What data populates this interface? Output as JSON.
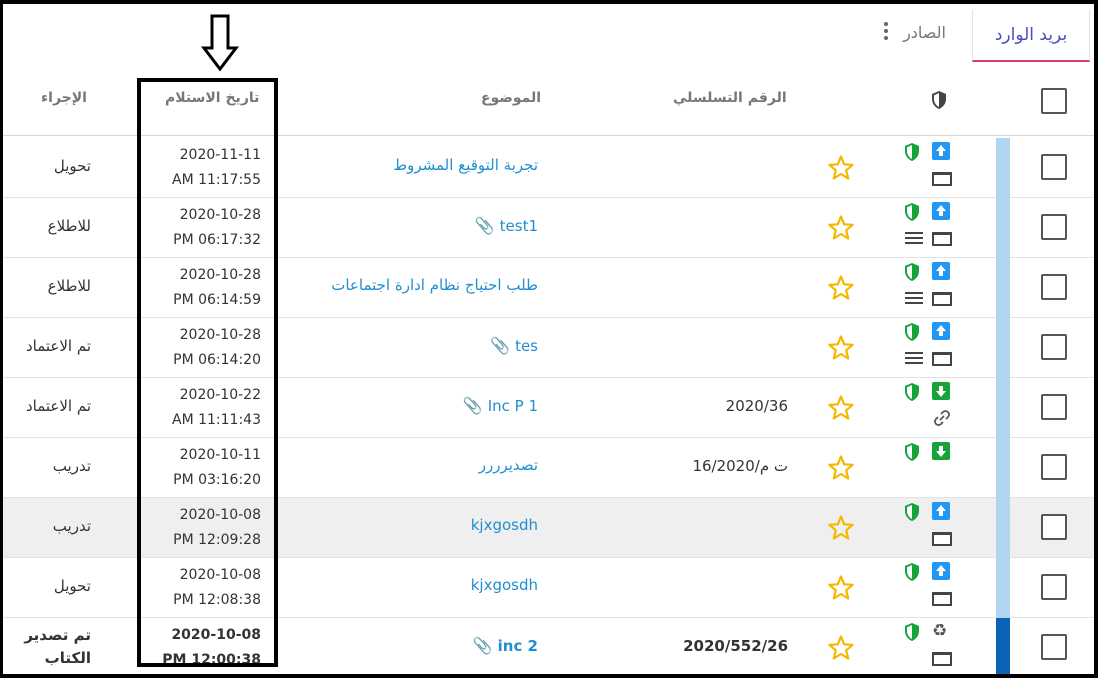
{
  "tabs": {
    "inbox": "بريد الوارد",
    "outbox": "الصادر"
  },
  "headers": {
    "action": "الإجراء",
    "date": "تاريخ الاستلام",
    "subject": "الموضوع",
    "serial": "الرقم التسلسلي"
  },
  "colors": {
    "link": "#1f8fd0",
    "shield": "#15a33a",
    "arrow": "#2196f3",
    "star": "#f5b800",
    "row_bar": "#b3d6f0",
    "row_bar_active": "#0b63b6",
    "tab_accent": "#d63a7a"
  },
  "rows": [
    {
      "action": "تحويل",
      "date": "2020-11-11",
      "time": "AM 11:17:55",
      "subject": "تجربة التوقيع المشروط",
      "serial": "",
      "arrow": "up",
      "second_icon": "screen"
    },
    {
      "action": "للاطلاع",
      "date": "2020-10-28",
      "time": "PM 06:17:32",
      "subject": "test1",
      "serial": "",
      "arrow": "up",
      "second_icon": "lines-screen"
    },
    {
      "action": "للاطلاع",
      "date": "2020-10-28",
      "time": "PM 06:14:59",
      "subject": "طلب احتياج نظام ادارة اجتماعات",
      "serial": "",
      "arrow": "up",
      "second_icon": "lines-screen"
    },
    {
      "action": "تم الاعتماد",
      "date": "2020-10-28",
      "time": "PM 06:14:20",
      "subject": "tes",
      "serial": "",
      "arrow": "up",
      "second_icon": "lines-screen"
    },
    {
      "action": "تم الاعتماد",
      "date": "2020-10-22",
      "time": "AM 11:11:43",
      "subject": "Inc P 1",
      "serial": "2020/36",
      "arrow": "down",
      "second_icon": "link"
    },
    {
      "action": "تدريب",
      "date": "2020-10-11",
      "time": "PM 03:16:20",
      "subject": "تصديرررر",
      "serial": "ت م/16/2020",
      "arrow": "down",
      "second_icon": "none"
    },
    {
      "action": "تدريب",
      "date": "2020-10-08",
      "time": "PM 12:09:28",
      "subject": "kjxgosdh",
      "serial": "",
      "arrow": "up",
      "second_icon": "screen"
    },
    {
      "action": "تحويل",
      "date": "2020-10-08",
      "time": "PM 12:08:38",
      "subject": "kjxgosdh",
      "serial": "",
      "arrow": "up",
      "second_icon": "screen"
    },
    {
      "action": "تم تصدير الكتاب",
      "date": "2020-10-08",
      "time": "PM 12:00:38",
      "subject": "inc 2",
      "serial": "2020/552/26",
      "arrow": "recycle",
      "second_icon": "screen"
    }
  ]
}
